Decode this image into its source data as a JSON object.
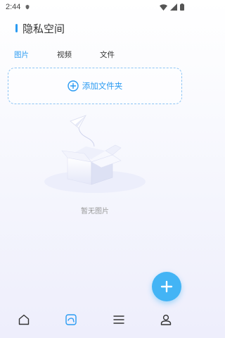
{
  "status_bar": {
    "time": "2:44"
  },
  "header": {
    "title": "隐私空间"
  },
  "tabs": [
    {
      "label": "图片",
      "active": true
    },
    {
      "label": "视频",
      "active": false
    },
    {
      "label": "文件",
      "active": false
    }
  ],
  "add_folder": {
    "label": "添加文件夹",
    "icon": "plus-circle-icon"
  },
  "empty_state": {
    "text": "暂无图片",
    "illustration": "empty-box-paper-plane"
  },
  "fab": {
    "icon": "plus-icon"
  },
  "bottom_nav": [
    {
      "icon": "home-icon",
      "active": false
    },
    {
      "icon": "gallery-icon",
      "active": true
    },
    {
      "icon": "menu-icon",
      "active": false
    },
    {
      "icon": "profile-icon",
      "active": false
    }
  ],
  "colors": {
    "accent": "#2a9bf2",
    "fab": "#43b4f5",
    "muted": "#999999"
  }
}
